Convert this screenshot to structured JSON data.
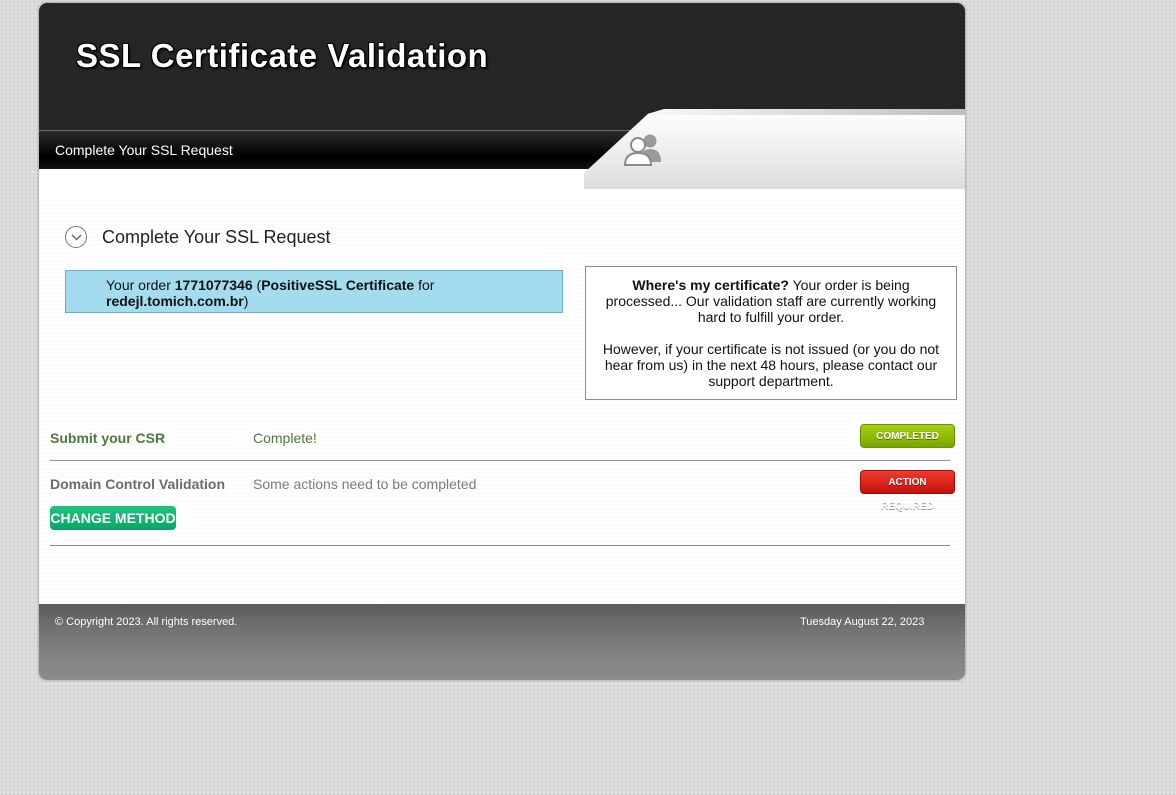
{
  "header": {
    "site_title": "SSL Certificate Validation",
    "nav_label": "Complete Your SSL Request",
    "account_icon": "users-icon"
  },
  "section": {
    "title": "Complete Your SSL Request",
    "toggle_icon": "chevron-down-icon"
  },
  "order": {
    "prefix": "Your order ",
    "order_number": "1771077346",
    "paren_open": " (",
    "product": "PositiveSSL Certificate",
    "for_text": " for",
    "domain": "redejl.tomich.com.br",
    "paren_close": ")"
  },
  "info": {
    "heading": "Where's my certificate?",
    "text1": " Your order is being processed... Our validation staff are currently working hard to fulfill your order.",
    "text2": "However, if your certificate is not issued (or you do not hear from us) in the next 48 hours, please contact our support department."
  },
  "steps": [
    {
      "label": "Submit your CSR",
      "status": "Complete!",
      "badge": "COMPLETED",
      "label_color": "#4c7a3a",
      "status_color": "#4c7a3a"
    },
    {
      "label": "Domain Control Validation",
      "status": "Some actions need to be completed",
      "badge": "ACTION REQUIRED",
      "label_color": "#6b6b6b",
      "status_color": "#7a7a7a"
    }
  ],
  "change_method_label": "CHANGE METHOD",
  "footer": {
    "copyright": "© Copyright 2023. All rights reserved.",
    "date": "Tuesday August 22, 2023"
  },
  "colors": {
    "order_box_bg": "#a3dbef",
    "completed_badge": "#8fbd06",
    "action_required_badge": "#e0251b",
    "change_method_button": "#10b572",
    "header_bg": "#262626"
  }
}
